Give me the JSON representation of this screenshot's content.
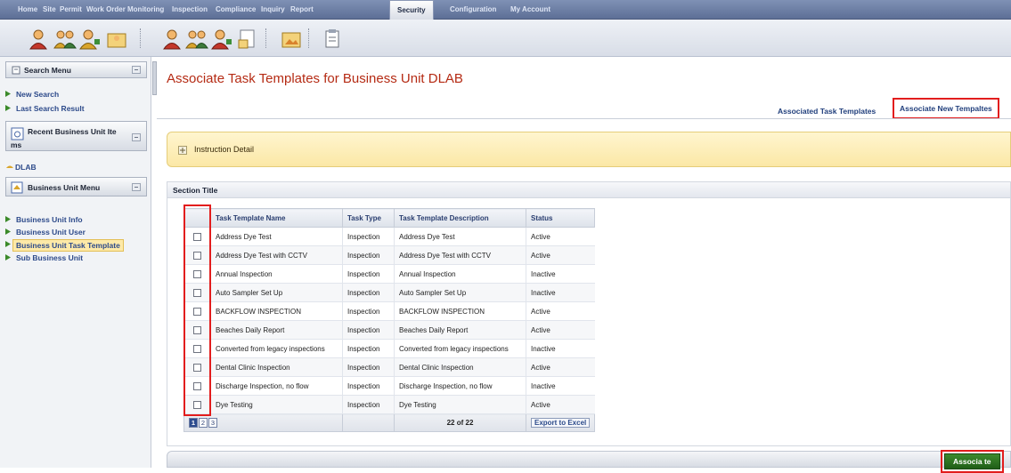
{
  "nav": {
    "items": [
      "Home",
      "Site",
      "Permit",
      "Work Order",
      "Monitoring",
      "Inspection",
      "Compliance",
      "Inquiry",
      "Report",
      "Security",
      "Configuration",
      "My Account"
    ],
    "active": "Security"
  },
  "toolbar": {
    "icons": [
      "user-icon",
      "users-group-icon",
      "user-add-icon",
      "user-folder-icon",
      "user-icon",
      "users-group-icon",
      "user-add-icon",
      "document-icon",
      "folder-image-icon",
      "clipboard-icon"
    ]
  },
  "sidebar": {
    "search_menu": {
      "title": "Search Menu",
      "links": [
        "New Search",
        "Last Search Result"
      ]
    },
    "recent": {
      "title_line1": "Recent Business Unit Ite",
      "title_line2": "ms",
      "items": [
        "DLAB"
      ]
    },
    "bu_menu": {
      "title": "Business Unit Menu",
      "links": [
        "Business Unit Info",
        "Business Unit User",
        "Business Unit Task Template",
        "Sub Business Unit"
      ],
      "active_index": 2
    }
  },
  "page": {
    "title": "Associate Task Templates for Business Unit DLAB",
    "tabs": [
      "Associated Task Templates",
      "Associate New Tempaltes"
    ],
    "selected_tab": 1,
    "instruction_label": "Instruction Detail",
    "section_title": "Section Title"
  },
  "table": {
    "columns": [
      "Task Template Name",
      "Task Type",
      "Task Template Description",
      "Status"
    ],
    "rows": [
      [
        "Address Dye Test",
        "Inspection",
        "Address Dye Test",
        "Active"
      ],
      [
        "Address Dye Test with CCTV",
        "Inspection",
        "Address Dye Test with CCTV",
        "Active"
      ],
      [
        "Annual Inspection",
        "Inspection",
        "Annual Inspection",
        "Inactive"
      ],
      [
        "Auto Sampler Set Up",
        "Inspection",
        "Auto Sampler Set Up",
        "Inactive"
      ],
      [
        "BACKFLOW INSPECTION",
        "Inspection",
        "BACKFLOW INSPECTION",
        "Active"
      ],
      [
        "Beaches Daily Report",
        "Inspection",
        "Beaches Daily Report",
        "Active"
      ],
      [
        "Converted from legacy inspections",
        "Inspection",
        "Converted from legacy inspections",
        "Inactive"
      ],
      [
        "Dental Clinic Inspection",
        "Inspection",
        "Dental Clinic Inspection",
        "Active"
      ],
      [
        "Discharge Inspection, no flow",
        "Inspection",
        "Discharge Inspection, no flow",
        "Inactive"
      ],
      [
        "Dye Testing",
        "Inspection",
        "Dye Testing",
        "Active"
      ]
    ],
    "pages": [
      "1",
      "2",
      "3"
    ],
    "current_page": "1",
    "count": "22 of 22",
    "export_label": "Export to Excel"
  },
  "footer": {
    "associate_label": "Associa te"
  },
  "colors": {
    "title": "#b52b14",
    "highlight": "#e21d1d",
    "link": "#2d4a8a",
    "associate_button": "#2f7a22"
  }
}
